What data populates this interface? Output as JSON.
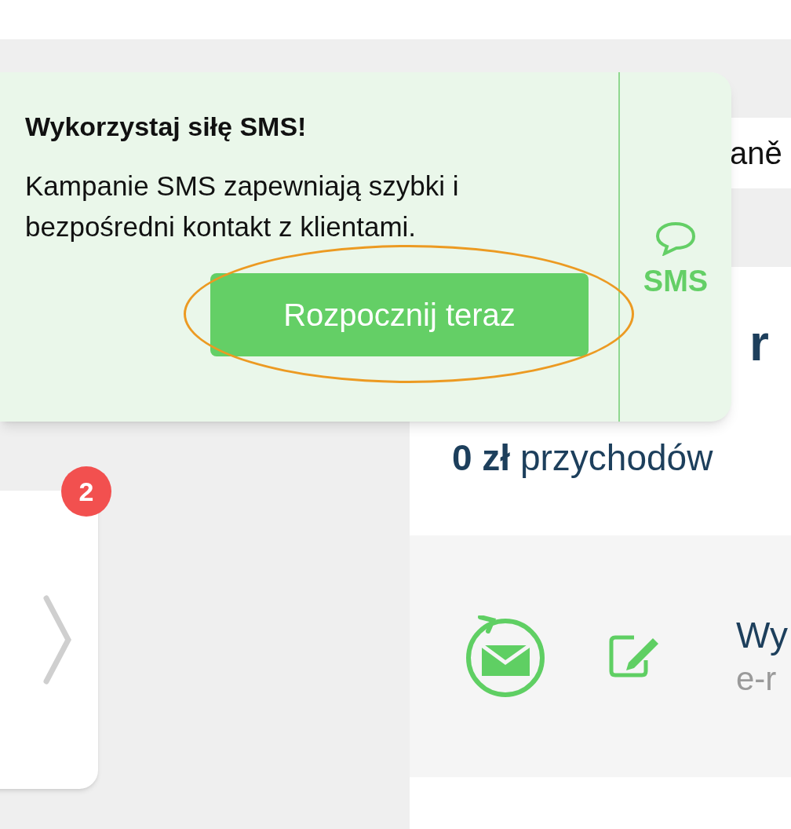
{
  "popup": {
    "title": "Wykorzystaj siłę SMS!",
    "body": "Kampanie SMS zapewniają szybki i bezpośredni kontakt z klientami.",
    "button": "Rozpocznij teraz",
    "highlighted": true,
    "side_label": "SMS"
  },
  "background": {
    "field_text": "aně",
    "heading": "r",
    "revenue": "**0 zł** przychodów",
    "email_card": {
      "title": "Wy",
      "subtitle": "e-r"
    },
    "side_card": {
      "badge": "2"
    }
  }
}
